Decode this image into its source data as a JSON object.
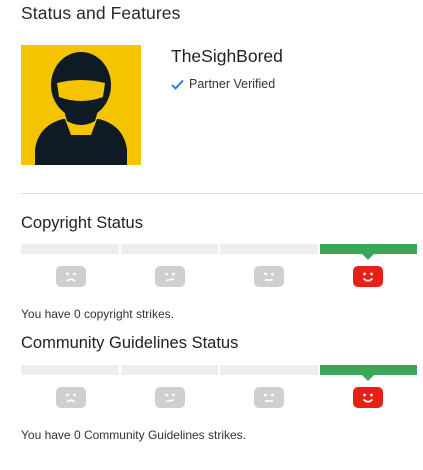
{
  "page": {
    "title": "Status and Features"
  },
  "channel": {
    "name": "TheSighBored",
    "verified_label": "Partner Verified"
  },
  "copyright": {
    "title": "Copyright Status",
    "strikes_text": "You have 0 copyright strikes.",
    "active_level": 4,
    "faces": [
      "sad-face-icon",
      "neutral-face-icon",
      "neutral-face-icon",
      "happy-face-icon"
    ]
  },
  "community": {
    "title": "Community Guidelines Status",
    "strikes_text": "You have 0 Community Guidelines strikes.",
    "active_level": 4,
    "faces": [
      "sad-face-icon",
      "neutral-face-icon",
      "neutral-face-icon",
      "happy-face-icon"
    ]
  },
  "colors": {
    "accent_green": "#3aa757",
    "active_red": "#e62117",
    "inactive_gray": "#cfcfcf",
    "avatar_yellow": "#f5c400",
    "verified_blue": "#1a73e8"
  }
}
